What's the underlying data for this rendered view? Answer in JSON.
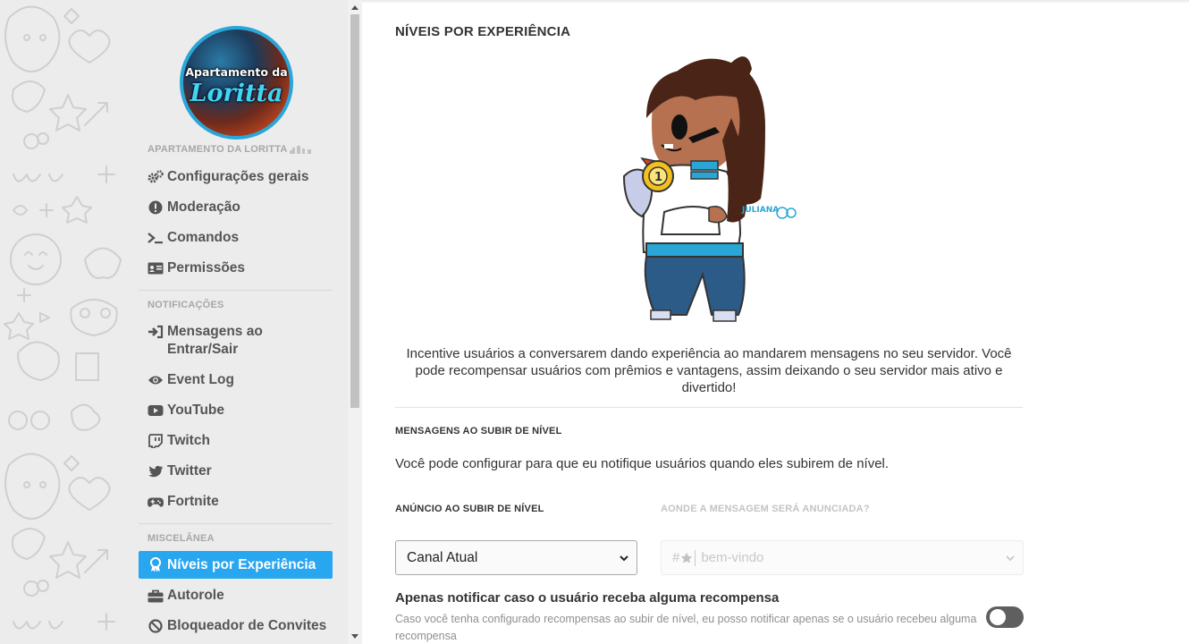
{
  "server": {
    "avatar_line1": "Apartamento da",
    "avatar_line2": "Loritta"
  },
  "sidebar": {
    "sections": [
      {
        "title": "APARTAMENTO DA LORITTA",
        "items": [
          {
            "label": "Configurações gerais",
            "icon": "gears-icon"
          },
          {
            "label": "Moderação",
            "icon": "exclamation-circle-icon"
          },
          {
            "label": "Comandos",
            "icon": "terminal-icon"
          },
          {
            "label": "Permissões",
            "icon": "id-card-icon"
          }
        ]
      },
      {
        "title": "NOTIFICAÇÕES",
        "items": [
          {
            "label": "Mensagens ao Entrar/Sair",
            "icon": "sign-in-icon"
          },
          {
            "label": "Event Log",
            "icon": "eye-icon"
          },
          {
            "label": "YouTube",
            "icon": "youtube-icon"
          },
          {
            "label": "Twitch",
            "icon": "twitch-icon"
          },
          {
            "label": "Twitter",
            "icon": "twitter-icon"
          },
          {
            "label": "Fortnite",
            "icon": "gamepad-icon"
          }
        ]
      },
      {
        "title": "MISCELÂNEA",
        "items": [
          {
            "label": "Níveis por Experiência",
            "icon": "award-icon",
            "active": true
          },
          {
            "label": "Autorole",
            "icon": "briefcase-icon"
          },
          {
            "label": "Bloqueador de Convites",
            "icon": "ban-icon"
          }
        ]
      }
    ]
  },
  "main": {
    "title": "NÍVEIS POR EXPERIÊNCIA",
    "intro": "Incentive usuários a conversarem dando experiência ao mandarem mensagens no seu servidor. Você pode recompensar usuários com prêmios e vantagens, assim deixando o seu servidor mais ativo e divertido!",
    "levelup_section": {
      "title": "MENSAGENS AO SUBIR DE NÍVEL",
      "description": "Você pode configurar para que eu notifique usuários quando eles subirem de nível."
    },
    "announcement_label": "ANÚNCIO AO SUBIR DE NÍVEL",
    "announcement_value": "Canal Atual",
    "channel_label": "AONDE A MENSAGEM SERÁ ANUNCIADA?",
    "channel_value": "bem-vindo",
    "channel_prefix": "#",
    "reward_option": {
      "title": "Apenas notificar caso o usuário receba alguma recompensa",
      "description": "Caso você tenha configurado recompensas ao subir de nível, eu posso notificar apenas se o usuário recebeu alguma recompensa",
      "enabled": false
    },
    "mascot_signature": "JULIANA"
  },
  "colors": {
    "accent": "#29a6f0",
    "avatar_ring": "#29a6d9",
    "toggle_off": "#5f5f5f"
  }
}
